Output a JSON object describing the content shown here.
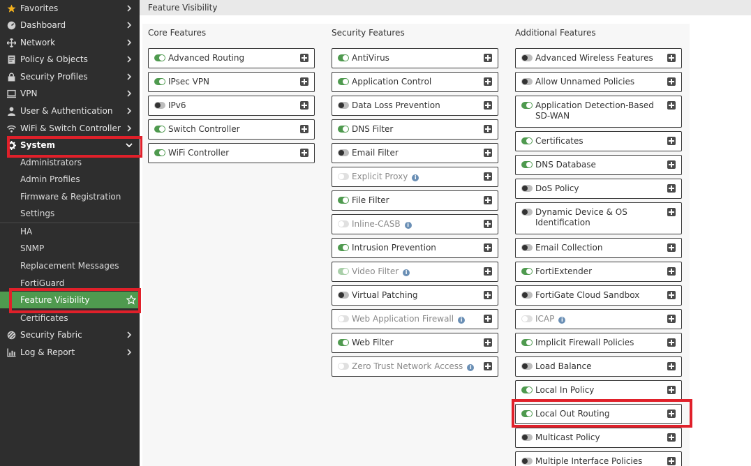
{
  "header": {
    "title": "Feature Visibility"
  },
  "sidebar": {
    "items": [
      {
        "label": "Favorites",
        "icon": "star-icon"
      },
      {
        "label": "Dashboard",
        "icon": "dashboard-icon"
      },
      {
        "label": "Network",
        "icon": "network-icon"
      },
      {
        "label": "Policy & Objects",
        "icon": "policy-icon"
      },
      {
        "label": "Security Profiles",
        "icon": "lock-icon"
      },
      {
        "label": "VPN",
        "icon": "monitor-icon"
      },
      {
        "label": "User & Authentication",
        "icon": "user-icon"
      },
      {
        "label": "WiFi & Switch Controller",
        "icon": "wifi-icon"
      },
      {
        "label": "System",
        "icon": "gear-icon"
      }
    ],
    "system_sub": [
      {
        "label": "Administrators"
      },
      {
        "label": "Admin Profiles"
      },
      {
        "label": "Firmware & Registration"
      },
      {
        "label": "Settings"
      },
      {
        "label": "HA"
      },
      {
        "label": "SNMP"
      },
      {
        "label": "Replacement Messages"
      },
      {
        "label": "FortiGuard"
      },
      {
        "label": "Feature Visibility"
      },
      {
        "label": "Certificates"
      }
    ],
    "bottom": [
      {
        "label": "Security Fabric",
        "icon": "fabric-icon"
      },
      {
        "label": "Log & Report",
        "icon": "chart-icon"
      }
    ]
  },
  "columns": {
    "core": {
      "title": "Core Features",
      "features": [
        {
          "label": "Advanced Routing",
          "enabled": true
        },
        {
          "label": "IPsec VPN",
          "enabled": true
        },
        {
          "label": "IPv6",
          "enabled": false
        },
        {
          "label": "Switch Controller",
          "enabled": true
        },
        {
          "label": "WiFi Controller",
          "enabled": true
        }
      ]
    },
    "security": {
      "title": "Security Features",
      "features": [
        {
          "label": "AntiVirus",
          "enabled": true
        },
        {
          "label": "Application Control",
          "enabled": true
        },
        {
          "label": "Data Loss Prevention",
          "enabled": false
        },
        {
          "label": "DNS Filter",
          "enabled": true
        },
        {
          "label": "Email Filter",
          "enabled": false
        },
        {
          "label": "Explicit Proxy",
          "enabled": false,
          "disabled": true
        },
        {
          "label": "File Filter",
          "enabled": true
        },
        {
          "label": "Inline-CASB",
          "enabled": false,
          "disabled": true
        },
        {
          "label": "Intrusion Prevention",
          "enabled": true
        },
        {
          "label": "Video Filter",
          "enabled": true,
          "disabled": true
        },
        {
          "label": "Virtual Patching",
          "enabled": false
        },
        {
          "label": "Web Application Firewall",
          "enabled": false,
          "disabled": true
        },
        {
          "label": "Web Filter",
          "enabled": true
        },
        {
          "label": "Zero Trust Network Access",
          "enabled": false,
          "disabled": true
        }
      ]
    },
    "additional": {
      "title": "Additional Features",
      "features": [
        {
          "label": "Advanced Wireless Features",
          "enabled": false
        },
        {
          "label": "Allow Unnamed Policies",
          "enabled": false
        },
        {
          "label": "Application Detection-Based SD-WAN",
          "enabled": true
        },
        {
          "label": "Certificates",
          "enabled": true
        },
        {
          "label": "DNS Database",
          "enabled": true
        },
        {
          "label": "DoS Policy",
          "enabled": false
        },
        {
          "label": "Dynamic Device & OS Identification",
          "enabled": false
        },
        {
          "label": "Email Collection",
          "enabled": false
        },
        {
          "label": "FortiExtender",
          "enabled": true
        },
        {
          "label": "FortiGate Cloud Sandbox",
          "enabled": false
        },
        {
          "label": "ICAP",
          "enabled": false,
          "disabled": true
        },
        {
          "label": "Implicit Firewall Policies",
          "enabled": true
        },
        {
          "label": "Load Balance",
          "enabled": false
        },
        {
          "label": "Local In Policy",
          "enabled": true
        },
        {
          "label": "Local Out Routing",
          "enabled": true
        },
        {
          "label": "Multicast Policy",
          "enabled": false
        },
        {
          "label": "Multiple Interface Policies",
          "enabled": false
        }
      ]
    }
  },
  "colors": {
    "accent": "#4f9a4f",
    "highlight": "#e0202a",
    "sidebar_bg": "#2e2e2e"
  }
}
